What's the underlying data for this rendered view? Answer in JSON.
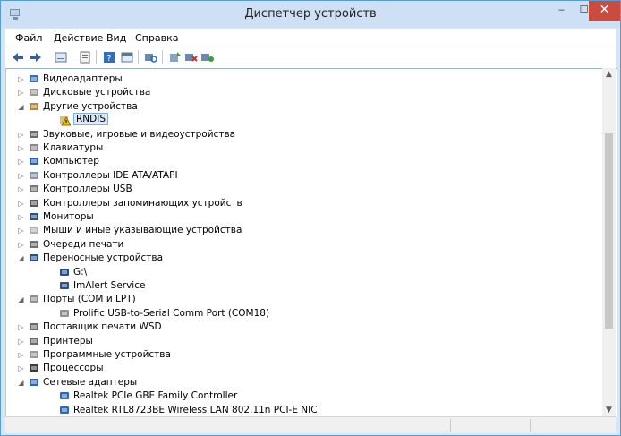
{
  "window": {
    "title": "Диспетчер устройств"
  },
  "menu": {
    "file": "Файл",
    "action": "Действие",
    "view": "Вид",
    "help": "Справка"
  },
  "toolbar": {
    "icons": [
      "back-arrow-icon",
      "forward-arrow-icon",
      "properties-icon",
      "show-hidden-icon",
      "help-icon",
      "device-view-icon",
      "scan-hardware-icon",
      "update-driver-icon",
      "uninstall-device-icon",
      "disable-device-icon"
    ]
  },
  "tree": [
    {
      "label": "Видеоадаптеры",
      "level": 1,
      "expander": "collapsed",
      "icon": "display-adapter-icon"
    },
    {
      "label": "Дисковые устройства",
      "level": 1,
      "expander": "collapsed",
      "icon": "disk-drive-icon"
    },
    {
      "label": "Другие устройства",
      "level": 1,
      "expander": "expanded",
      "icon": "other-devices-icon"
    },
    {
      "label": "RNDIS",
      "level": 2,
      "expander": "none",
      "icon": "unknown-device-warning-icon",
      "selected": true
    },
    {
      "label": "Звуковые, игровые и видеоустройства",
      "level": 1,
      "expander": "collapsed",
      "icon": "speaker-icon"
    },
    {
      "label": "Клавиатуры",
      "level": 1,
      "expander": "collapsed",
      "icon": "keyboard-icon"
    },
    {
      "label": "Компьютер",
      "level": 1,
      "expander": "collapsed",
      "icon": "computer-icon"
    },
    {
      "label": "Контроллеры IDE ATA/ATAPI",
      "level": 1,
      "expander": "collapsed",
      "icon": "ide-controller-icon"
    },
    {
      "label": "Контроллеры USB",
      "level": 1,
      "expander": "collapsed",
      "icon": "usb-icon"
    },
    {
      "label": "Контроллеры запоминающих устройств",
      "level": 1,
      "expander": "collapsed",
      "icon": "storage-controller-icon"
    },
    {
      "label": "Мониторы",
      "level": 1,
      "expander": "collapsed",
      "icon": "monitor-icon"
    },
    {
      "label": "Мыши и иные указывающие устройства",
      "level": 1,
      "expander": "collapsed",
      "icon": "mouse-icon"
    },
    {
      "label": "Очереди печати",
      "level": 1,
      "expander": "collapsed",
      "icon": "print-queue-icon"
    },
    {
      "label": "Переносные устройства",
      "level": 1,
      "expander": "expanded",
      "icon": "portable-device-icon"
    },
    {
      "label": "G:\\",
      "level": 2,
      "expander": "none",
      "icon": "portable-device-icon"
    },
    {
      "label": "ImAlert Service",
      "level": 2,
      "expander": "none",
      "icon": "portable-device-icon"
    },
    {
      "label": "Порты (COM и LPT)",
      "level": 1,
      "expander": "expanded",
      "icon": "port-icon"
    },
    {
      "label": "Prolific USB-to-Serial Comm Port (COM18)",
      "level": 2,
      "expander": "none",
      "icon": "port-icon"
    },
    {
      "label": "Поставщик печати WSD",
      "level": 1,
      "expander": "collapsed",
      "icon": "printer-icon"
    },
    {
      "label": "Принтеры",
      "level": 1,
      "expander": "collapsed",
      "icon": "printer-icon"
    },
    {
      "label": "Программные устройства",
      "level": 1,
      "expander": "collapsed",
      "icon": "software-device-icon"
    },
    {
      "label": "Процессоры",
      "level": 1,
      "expander": "collapsed",
      "icon": "processor-icon"
    },
    {
      "label": "Сетевые адаптеры",
      "level": 1,
      "expander": "expanded",
      "icon": "network-adapter-icon"
    },
    {
      "label": "Realtek PCIe GBE Family Controller",
      "level": 2,
      "expander": "none",
      "icon": "network-adapter-icon"
    },
    {
      "label": "Realtek RTL8723BE Wireless LAN 802.11n PCI-E NIC",
      "level": 2,
      "expander": "none",
      "icon": "network-adapter-icon"
    }
  ],
  "colors": {
    "accent": "#5b9bd5",
    "close": "#c94c3f",
    "selection": "#dceaf7"
  }
}
